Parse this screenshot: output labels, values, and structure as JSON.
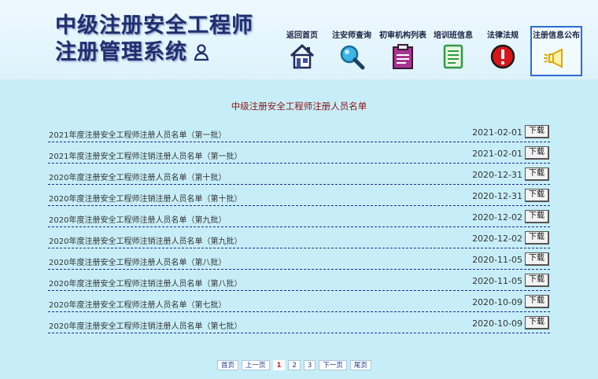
{
  "header": {
    "title_line1": "中级注册安全工程师",
    "title_line2": "注册管理系统"
  },
  "nav": [
    {
      "label": "返回首页",
      "icon": "house-icon"
    },
    {
      "label": "注安师查询",
      "icon": "magnifier-icon"
    },
    {
      "label": "初审机构列表",
      "icon": "clipboard-icon"
    },
    {
      "label": "培训班信息",
      "icon": "document-icon"
    },
    {
      "label": "法律法规",
      "icon": "alert-icon"
    },
    {
      "label": "注册信息公布",
      "icon": "megaphone-icon",
      "active": true
    }
  ],
  "list_title": "中级注册安全工程师注册人员名单",
  "download_label": "下载",
  "rows": [
    {
      "name": "2021年度注册安全工程师注册人员名单（第一批）",
      "date": "2021-02-01"
    },
    {
      "name": "2021年度注册安全工程师注销注册人员名单（第一批）",
      "date": "2021-02-01"
    },
    {
      "name": "2020年度注册安全工程师注册人员名单（第十批）",
      "date": "2020-12-31"
    },
    {
      "name": "2020年度注册安全工程师注销注册人员名单（第十批）",
      "date": "2020-12-31"
    },
    {
      "name": "2020年度注册安全工程师注册人员名单（第九批）",
      "date": "2020-12-02"
    },
    {
      "name": "2020年度注册安全工程师注销注册人员名单（第九批）",
      "date": "2020-12-02"
    },
    {
      "name": "2020年度注册安全工程师注册人员名单（第八批）",
      "date": "2020-11-05"
    },
    {
      "name": "2020年度注册安全工程师注销注册人员名单（第八批）",
      "date": "2020-11-05"
    },
    {
      "name": "2020年度注册安全工程师注册人员名单（第七批）",
      "date": "2020-10-09"
    },
    {
      "name": "2020年度注册安全工程师注销注册人员名单（第七批）",
      "date": "2020-10-09"
    }
  ],
  "pagination": {
    "first": "首页",
    "prev": "上一页",
    "pages": [
      "1",
      "2",
      "3"
    ],
    "current": "1",
    "next": "下一页",
    "last": "尾页"
  }
}
